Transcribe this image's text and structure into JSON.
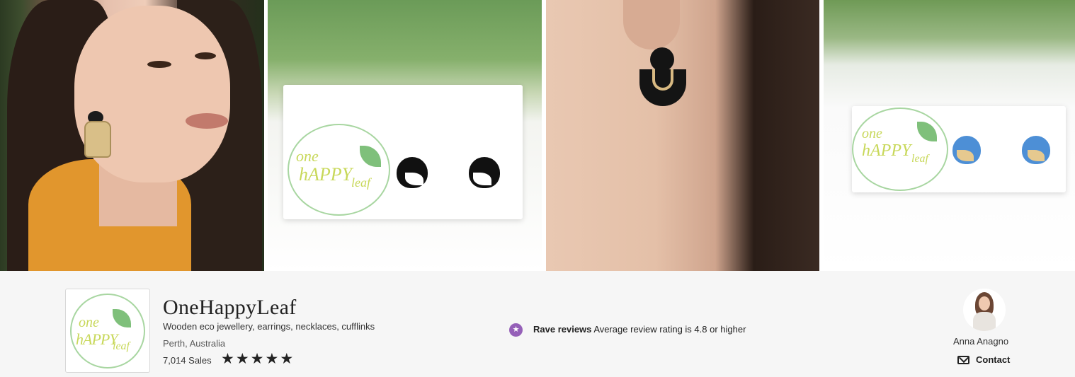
{
  "banner": {
    "images": [
      {
        "alt_name": "model-wearing-earring"
      },
      {
        "alt_name": "penguin-studs-on-card"
      },
      {
        "alt_name": "black-circle-earring"
      },
      {
        "alt_name": "blue-wren-studs-on-card"
      }
    ],
    "card_logo": {
      "word1": "one",
      "word2": "hAPPY",
      "word3": "leaf"
    }
  },
  "shop": {
    "logo": {
      "word1": "one",
      "word2": "hAPPY",
      "word3": "leaf"
    },
    "name": "OneHappyLeaf",
    "tagline": "Wooden eco jewellery, earrings, necklaces, cufflinks",
    "location": "Perth, Australia",
    "sales": "7,014 Sales",
    "rating": 5,
    "star_glyph": "★"
  },
  "badge": {
    "icon": "★",
    "title": "Rave reviews",
    "description": "Average review rating is 4.8 or higher",
    "accent": "#9560b8"
  },
  "owner": {
    "name": "Anna Anagno",
    "contact_label": "Contact"
  }
}
